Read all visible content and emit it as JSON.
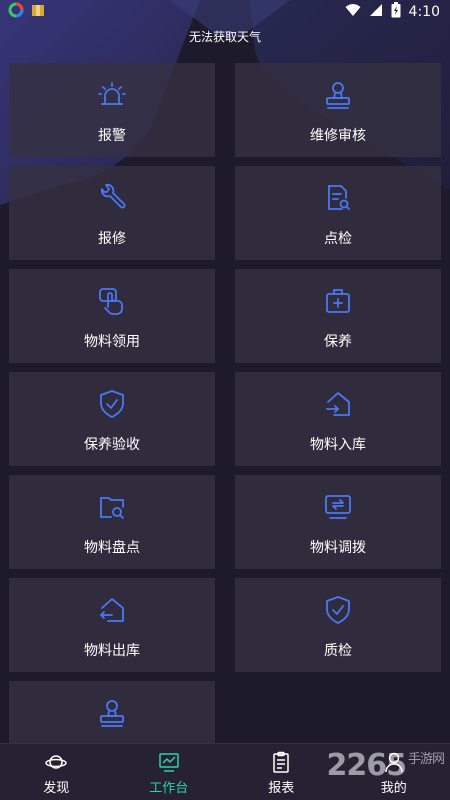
{
  "status_bar": {
    "time": "4:10"
  },
  "weather_text": "无法获取天气",
  "accent_color": "#4a78f5",
  "active_tab_color": "#2fd3a6",
  "cards": [
    {
      "label": "报警",
      "icon": "alarm-light-icon"
    },
    {
      "label": "维修审核",
      "icon": "stamp-icon"
    },
    {
      "label": "报修",
      "icon": "wrench-icon"
    },
    {
      "label": "点检",
      "icon": "document-search-icon"
    },
    {
      "label": "物料领用",
      "icon": "tap-hand-icon"
    },
    {
      "label": "保养",
      "icon": "medical-kit-icon"
    },
    {
      "label": "保养验收",
      "icon": "shield-check-icon"
    },
    {
      "label": "物料入库",
      "icon": "warehouse-in-icon"
    },
    {
      "label": "物料盘点",
      "icon": "folder-search-icon"
    },
    {
      "label": "物料调拨",
      "icon": "transfer-monitor-icon"
    },
    {
      "label": "物料出库",
      "icon": "warehouse-out-icon"
    },
    {
      "label": "质检",
      "icon": "shield-check-icon"
    },
    {
      "label": "",
      "icon": "stamp-icon"
    }
  ],
  "bottom_nav": [
    {
      "label": "发现",
      "icon": "planet-icon"
    },
    {
      "label": "工作台",
      "icon": "monitor-chart-icon",
      "active": true
    },
    {
      "label": "报表",
      "icon": "clipboard-icon"
    },
    {
      "label": "我的",
      "icon": "person-icon"
    }
  ],
  "watermark": {
    "main": "2265",
    "sub": "手游网"
  }
}
